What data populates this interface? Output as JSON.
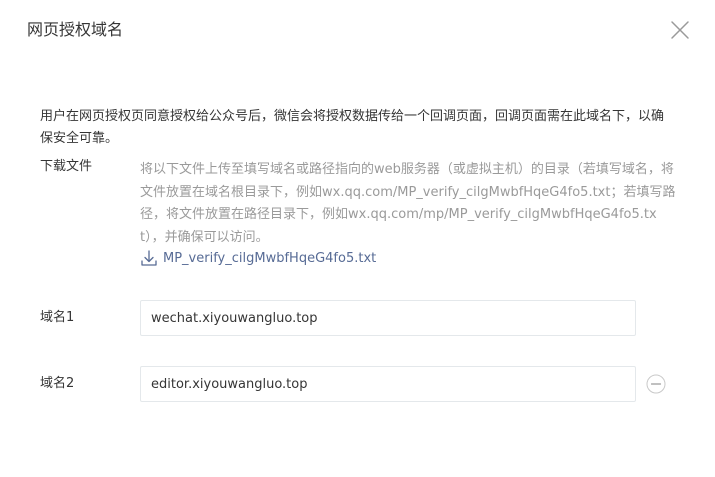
{
  "dialog": {
    "title": "网页授权域名",
    "intro": "用户在网页授权页同意授权给公众号后，微信会将授权数据传给一个回调页面，回调页面需在此域名下，以确保安全可靠。",
    "download": {
      "label": "下载文件",
      "description": "将以下文件上传至填写域名或路径指向的web服务器（或虚拟主机）的目录（若填写域名，将文件放置在域名根目录下，例如wx.qq.com/MP_verify_cilgMwbfHqeG4fo5.txt；若填写路径，将文件放置在路径目录下，例如wx.qq.com/mp/MP_verify_cilgMwbfHqeG4fo5.txt），并确保可以访问。",
      "file_name": "MP_verify_cilgMwbfHqeG4fo5.txt",
      "icon": "download-icon"
    },
    "domains": [
      {
        "label": "域名1",
        "value": "wechat.xiyouwangluo.top"
      },
      {
        "label": "域名2",
        "value": "editor.xiyouwangluo.top"
      }
    ],
    "colors": {
      "link": "#576b95",
      "muted_text": "#9a9a9a",
      "text": "#353535",
      "input_border": "#e4e8eb"
    }
  }
}
